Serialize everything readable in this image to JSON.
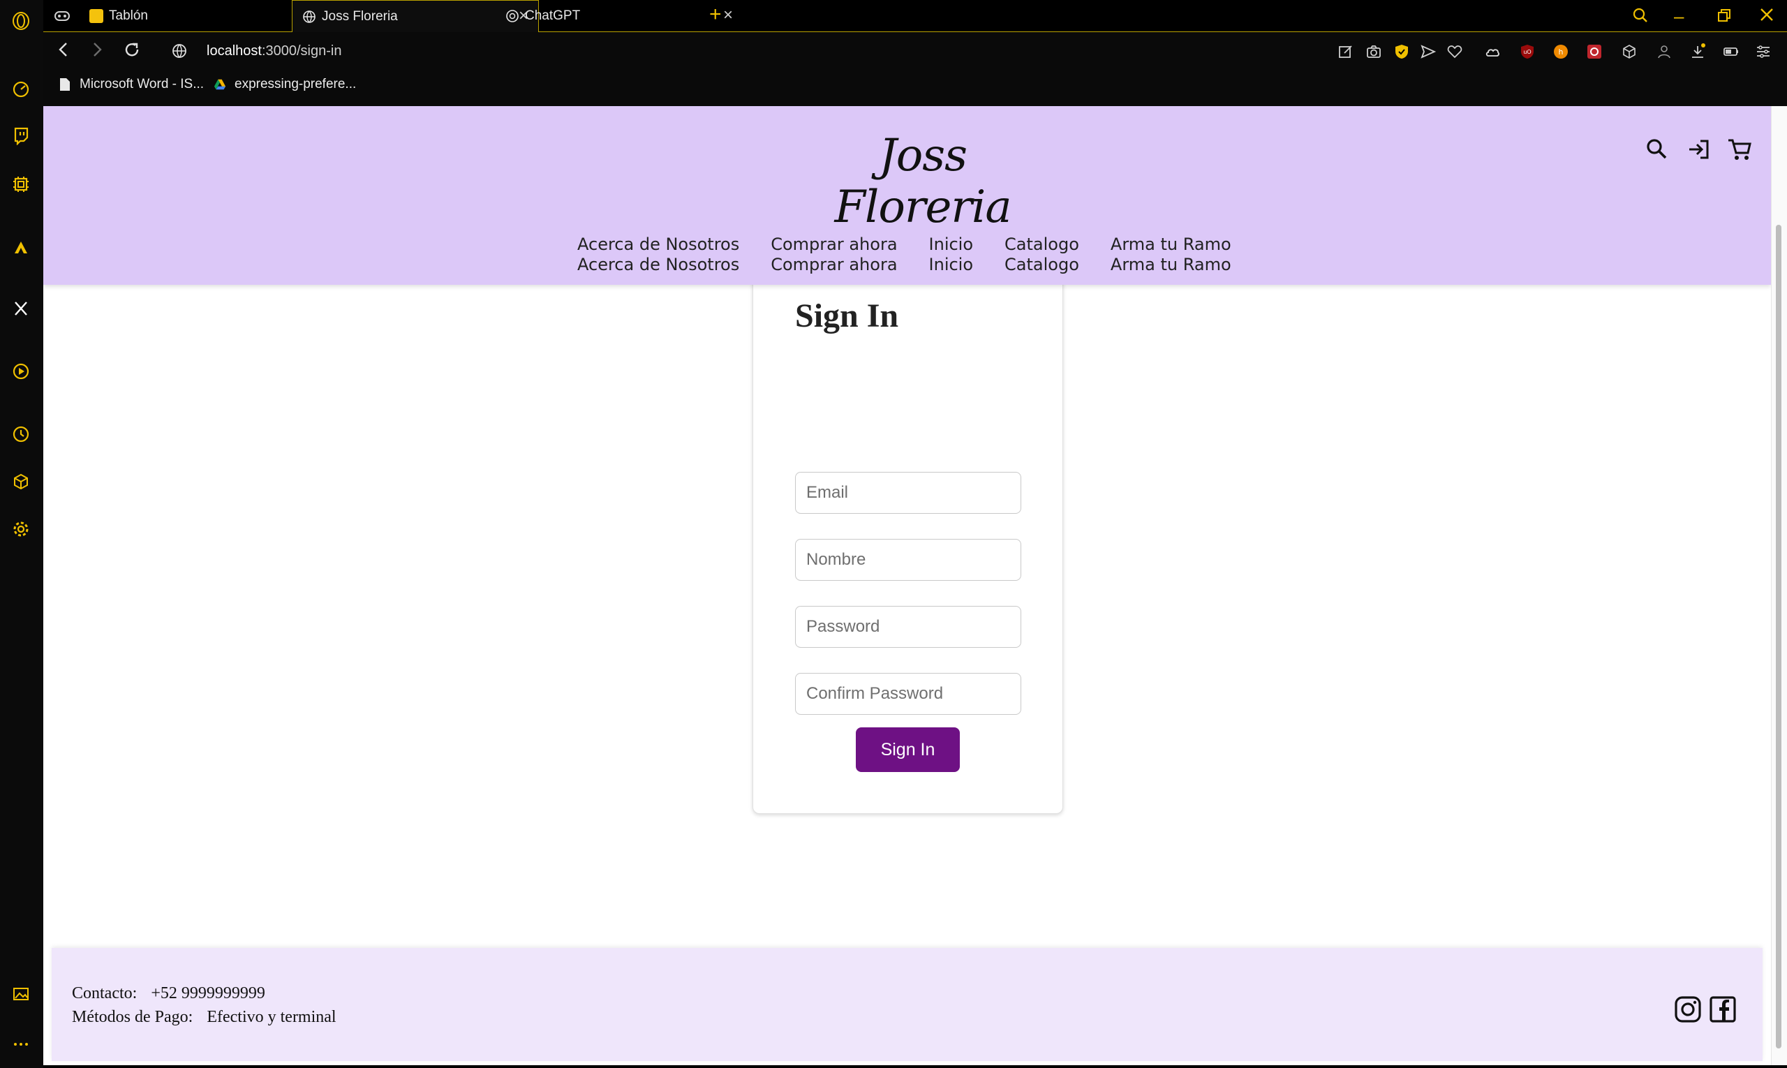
{
  "tabs": [
    {
      "label": "Tablón"
    },
    {
      "label": "Joss Floreria"
    },
    {
      "label": "ChatGPT"
    }
  ],
  "address": {
    "host": "localhost",
    "path": ":3000/sign-in"
  },
  "bookmarks": [
    {
      "label": "Microsoft Word - IS..."
    },
    {
      "label": "expressing-prefere..."
    }
  ],
  "site": {
    "logo": "Joss Floreria",
    "nav": [
      {
        "label": "Acerca de Nosotros"
      },
      {
        "label": "Comprar ahora"
      },
      {
        "label": "Inicio"
      },
      {
        "label": "Catalogo"
      },
      {
        "label": "Arma tu Ramo"
      }
    ]
  },
  "signin": {
    "title": "Sign In",
    "email_placeholder": "Email",
    "name_placeholder": "Nombre",
    "password_placeholder": "Password",
    "confirm_placeholder": "Confirm Password",
    "button": "Sign In"
  },
  "footer": {
    "contact_label": "Contacto:",
    "contact_value": "+52 9999999999",
    "payment_label": "Métodos de Pago:",
    "payment_value": "Efectivo y terminal"
  },
  "colors": {
    "header_bg": "#dcc8f8",
    "footer_bg": "#efe6fb",
    "button": "#6e1184",
    "browser_accent": "#f0c000"
  },
  "icons": [
    "search-icon",
    "login-icon",
    "cart-icon",
    "instagram-icon",
    "facebook-icon"
  ]
}
